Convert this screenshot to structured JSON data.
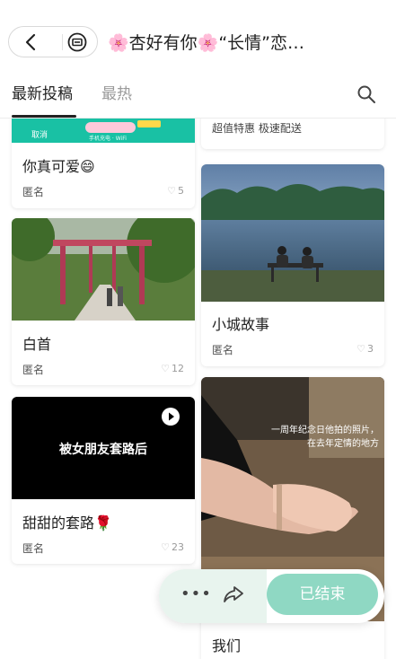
{
  "header": {
    "title": "🌸杏好有你🌸“长情”恋…"
  },
  "tabs": [
    {
      "label": "最新投稿"
    },
    {
      "label": "最热"
    }
  ],
  "cards": [
    {
      "title": "你真可爱😄",
      "author": "匿名",
      "likes": "5",
      "banner_left": "取消",
      "banner_mid": "手机充电 · WiFi"
    },
    {
      "title": "超值特惠 极速配送"
    },
    {
      "title": "小城故事",
      "author": "匿名",
      "likes": "3"
    },
    {
      "title": "白首",
      "author": "匿名",
      "likes": "12"
    },
    {
      "title": "甜甜的套路🌹",
      "author": "匿名",
      "likes": "23",
      "video_caption": "被女朋友套路后"
    },
    {
      "title": "我们",
      "photo_caption": "一周年纪念日他拍的照片，在去年定情的地方"
    }
  ],
  "actions": {
    "more": "•••",
    "end_label": "已结束"
  },
  "colors": {
    "accent_green": "#8fd8c3",
    "pill_bg": "#e8f4ee",
    "teal_banner": "#19c1a4"
  }
}
